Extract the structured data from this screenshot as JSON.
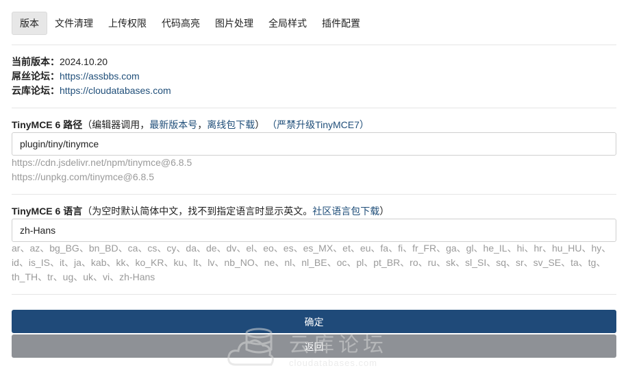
{
  "tabs": [
    "版本",
    "文件清理",
    "上传权限",
    "代码高亮",
    "图片处理",
    "全局样式",
    "插件配置"
  ],
  "info": {
    "version_label": "当前版本：",
    "version_value": "2024.10.20",
    "forum1_label": "屌丝论坛：",
    "forum1_url": "https://assbbs.com",
    "forum2_label": "云库论坛：",
    "forum2_url": "https://cloudatabases.com"
  },
  "path_field": {
    "label_bold": "TinyMCE 6 路径",
    "label_note_open": "（编辑器调用，",
    "link_latest": "最新版本号",
    "sep": "，",
    "link_offline": "离线包下载",
    "label_note_close": "）",
    "warn": "（严禁升级TinyMCE7）",
    "value": "plugin/tiny/tinymce",
    "hint1": "https://cdn.jsdelivr.net/npm/tinymce@6.8.5",
    "hint2": "https://unpkg.com/tinymce@6.8.5"
  },
  "lang_field": {
    "label_bold": "TinyMCE 6 语言",
    "label_note": "（为空时默认简体中文，找不到指定语言时显示英文。",
    "link_lang": "社区语言包下载",
    "label_close": "）",
    "value": "zh-Hans",
    "hint": "ar、az、bg_BG、bn_BD、ca、cs、cy、da、de、dv、el、eo、es、es_MX、et、eu、fa、fi、fr_FR、ga、gl、he_IL、hi、hr、hu_HU、hy、id、is_IS、it、ja、kab、kk、ko_KR、ku、lt、lv、nb_NO、ne、nl、nl_BE、oc、pl、pt_BR、ro、ru、sk、sl_SI、sq、sr、sv_SE、ta、tg、th_TH、tr、ug、uk、vi、zh-Hans"
  },
  "buttons": {
    "confirm": "确定",
    "back": "返回"
  },
  "watermark": {
    "title": "云库论坛",
    "subtitle": "cloudatabases.com"
  },
  "colors": {
    "primary": "#1f4a79",
    "secondary": "#8e9196",
    "link": "#1f4e79"
  }
}
